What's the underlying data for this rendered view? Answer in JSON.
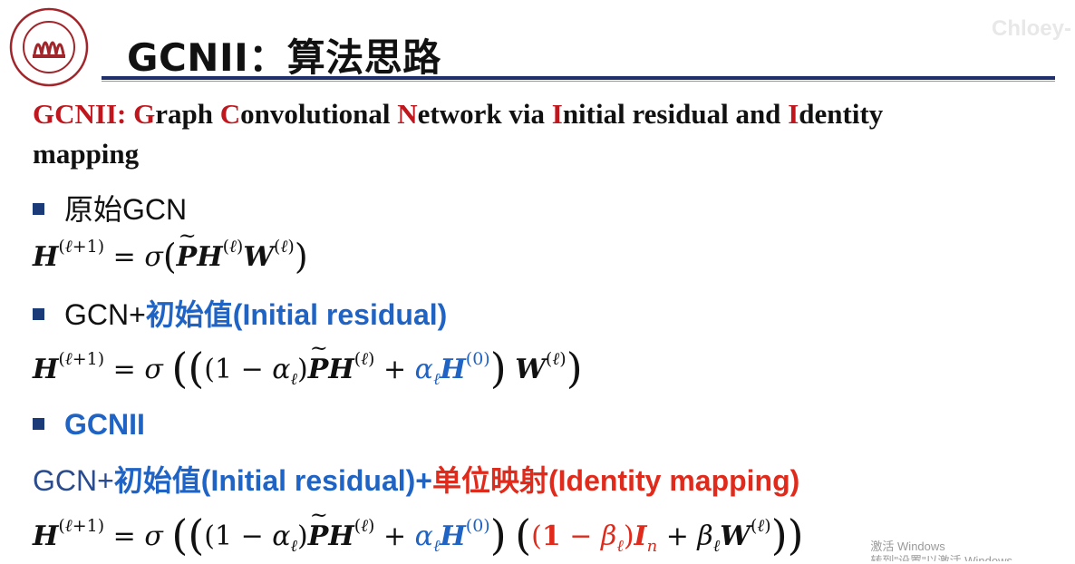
{
  "header": {
    "title": "GCNII：算法思路",
    "watermark_user": "Chloey-",
    "logo_text_top": "RENMIN UNIVERSITY OF CHINA",
    "logo_year": "1937",
    "logo_text_bottom": "中国人民大学"
  },
  "subtitle": {
    "acronym": "GCNII: ",
    "w1_cap": "G",
    "w1_rest": "raph ",
    "w2_cap": "C",
    "w2_rest": "onvolutional ",
    "w3_cap": "N",
    "w3_rest": "etwork via ",
    "w4_cap": "I",
    "w4_rest": "nitial residual and ",
    "w5_cap": "I",
    "w5_rest": "dentity",
    "line2": "mapping"
  },
  "sections": [
    {
      "label": "原始GCN"
    },
    {
      "label_prefix": "GCN+",
      "label_highlight": "初始值(Initial residual)"
    },
    {
      "label": "GCNII"
    }
  ],
  "gcnii_desc": {
    "prefix": "GCN+",
    "part1": "初始值(Initial residual)+",
    "part2": "单位映射(Identity mapping)"
  },
  "colors": {
    "title_rule": "#1f2f6b",
    "red": "#c0161d",
    "blue": "#1f63c5",
    "bright_red": "#e02b1c",
    "bullet": "#1b3a78"
  },
  "windows_watermark": {
    "line1": "激活 Windows",
    "line2": "转到\"设置\"以激活 Windows。"
  }
}
